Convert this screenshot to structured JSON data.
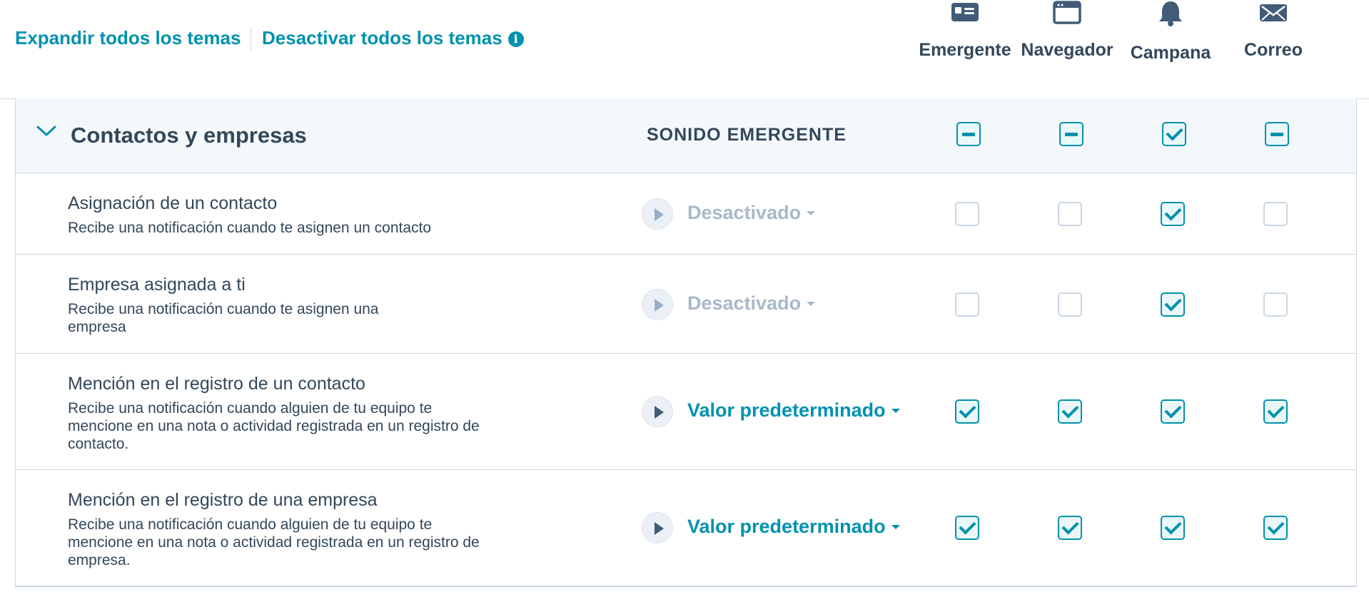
{
  "toolbar": {
    "expand_all": "Expandir todos los temas",
    "disable_all": "Desactivar todos los temas",
    "info_glyph": "i"
  },
  "channels": [
    {
      "label": "Emergente",
      "icon": "popup-card-icon"
    },
    {
      "label": "Navegador",
      "icon": "browser-window-icon"
    },
    {
      "label": "Campana",
      "icon": "bell-icon"
    },
    {
      "label": "Correo",
      "icon": "envelope-icon"
    }
  ],
  "group": {
    "title": "Contactos y empresas",
    "sound_header": "SONIDO EMERGENTE",
    "states": [
      "partial",
      "partial",
      "checked",
      "partial"
    ]
  },
  "rows": [
    {
      "title": "Asignación de un contacto",
      "description": "Recibe una notificación cuando te asignen un contacto",
      "sound": "Desactivado",
      "sound_enabled": false,
      "checks": [
        false,
        false,
        true,
        false
      ]
    },
    {
      "title": "Empresa asignada a ti",
      "description": "Recibe una notificación cuando te asignen una empresa",
      "sound": "Desactivado",
      "sound_enabled": false,
      "checks": [
        false,
        false,
        true,
        false
      ]
    },
    {
      "title": "Mención en el registro de un contacto",
      "description": "Recibe una notificación cuando alguien de tu equipo te mencione en una nota o actividad registrada en un registro de contacto.",
      "sound": "Valor predeterminado",
      "sound_enabled": true,
      "checks": [
        true,
        true,
        true,
        true
      ]
    },
    {
      "title": "Mención en el registro de una empresa",
      "description": "Recibe una notificación cuando alguien de tu equipo te mencione en una nota o actividad registrada en un registro de empresa.",
      "sound": "Valor predeterminado",
      "sound_enabled": true,
      "checks": [
        true,
        true,
        true,
        true
      ]
    }
  ],
  "colors": {
    "accent": "#0091ae",
    "text": "#33475b",
    "disabled": "#a9b8c9",
    "border": "#cbd6e2",
    "header_bg": "#f5f8fa"
  }
}
